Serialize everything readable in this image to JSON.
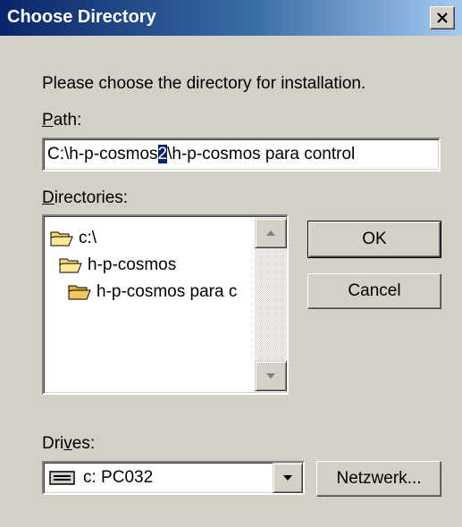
{
  "window": {
    "title": "Choose Directory"
  },
  "instructions": "Please choose the directory for installation.",
  "path": {
    "label_accel": "P",
    "label_rest": "ath:",
    "value_before": "C:\\h-p-cosmos",
    "value_highlight": "2",
    "value_after": "\\h-p-cosmos para control"
  },
  "directories": {
    "label_accel": "D",
    "label_rest": "irectories:",
    "items": [
      {
        "label": "c:\\",
        "icon": "open-folder-icon"
      },
      {
        "label": "h-p-cosmos",
        "icon": "open-folder-icon"
      },
      {
        "label": "h-p-cosmos para c",
        "icon": "open-folder-icon"
      }
    ]
  },
  "buttons": {
    "ok": "OK",
    "cancel": "Cancel",
    "network": "Netzwerk..."
  },
  "drives": {
    "label_pre": "Dri",
    "label_accel": "v",
    "label_post": "es:",
    "selected": "c: PC032",
    "icon": "hard-drive-icon"
  },
  "colors": {
    "titlebar": "#0a246a",
    "face": "#d4d0c8",
    "highlight": "#0a246a"
  }
}
